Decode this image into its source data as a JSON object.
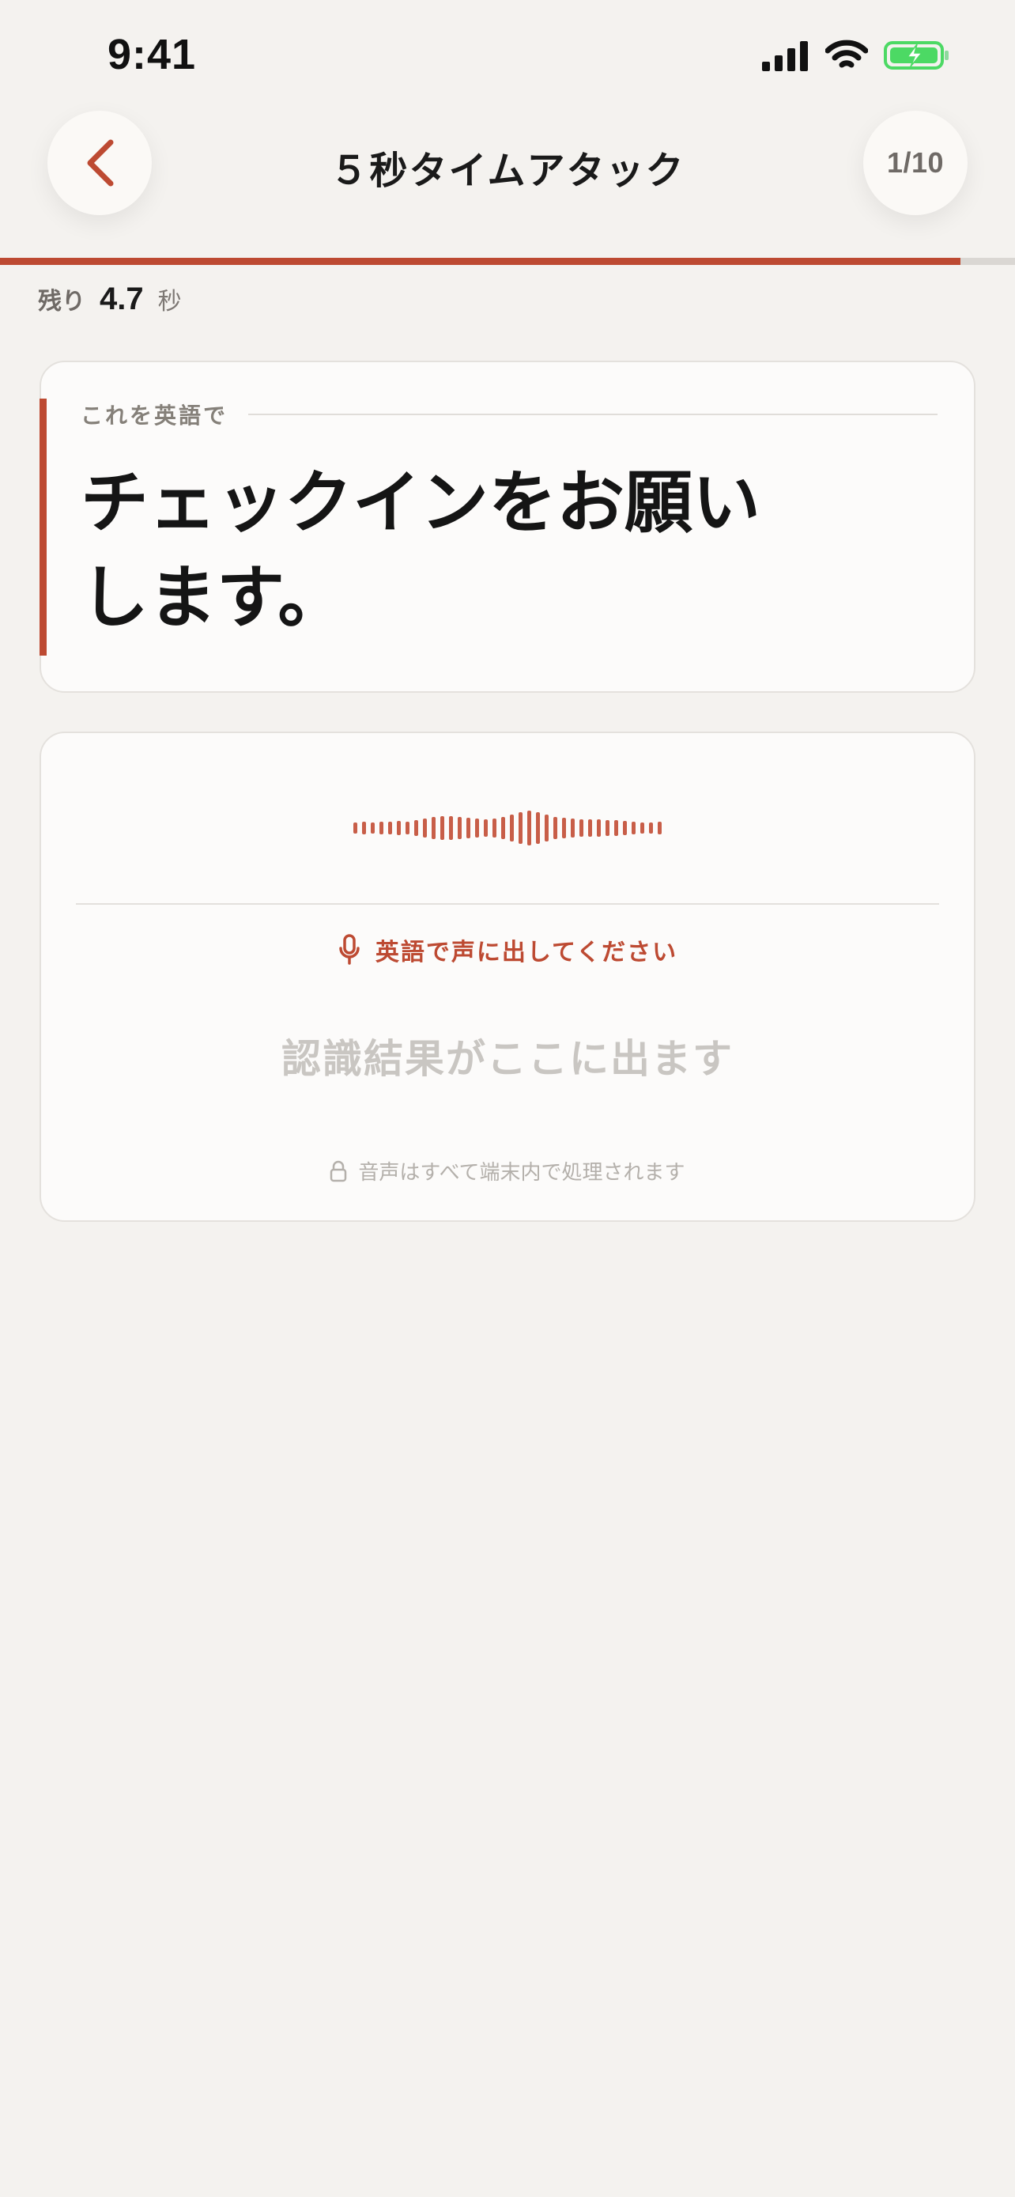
{
  "status_bar": {
    "time": "9:41"
  },
  "header": {
    "title": "５秒タイムアタック",
    "counter": "1/10"
  },
  "progress": {
    "fraction": 0.946
  },
  "timer": {
    "label": "残り",
    "value": "4.7",
    "unit": "秒"
  },
  "prompt": {
    "label": "これを英語で",
    "text": "チェックインをお願いします。"
  },
  "voice": {
    "instruction": "英語で声に出してください",
    "recognition_placeholder": "認識結果がここに出ます",
    "privacy_note": "音声はすべて端末内で処理されます"
  },
  "colors": {
    "accent": "#bd4a32",
    "battery": "#4cd964"
  },
  "icons": {
    "back": "chevron-left-icon",
    "mic": "microphone-icon",
    "lock": "lock-icon"
  }
}
